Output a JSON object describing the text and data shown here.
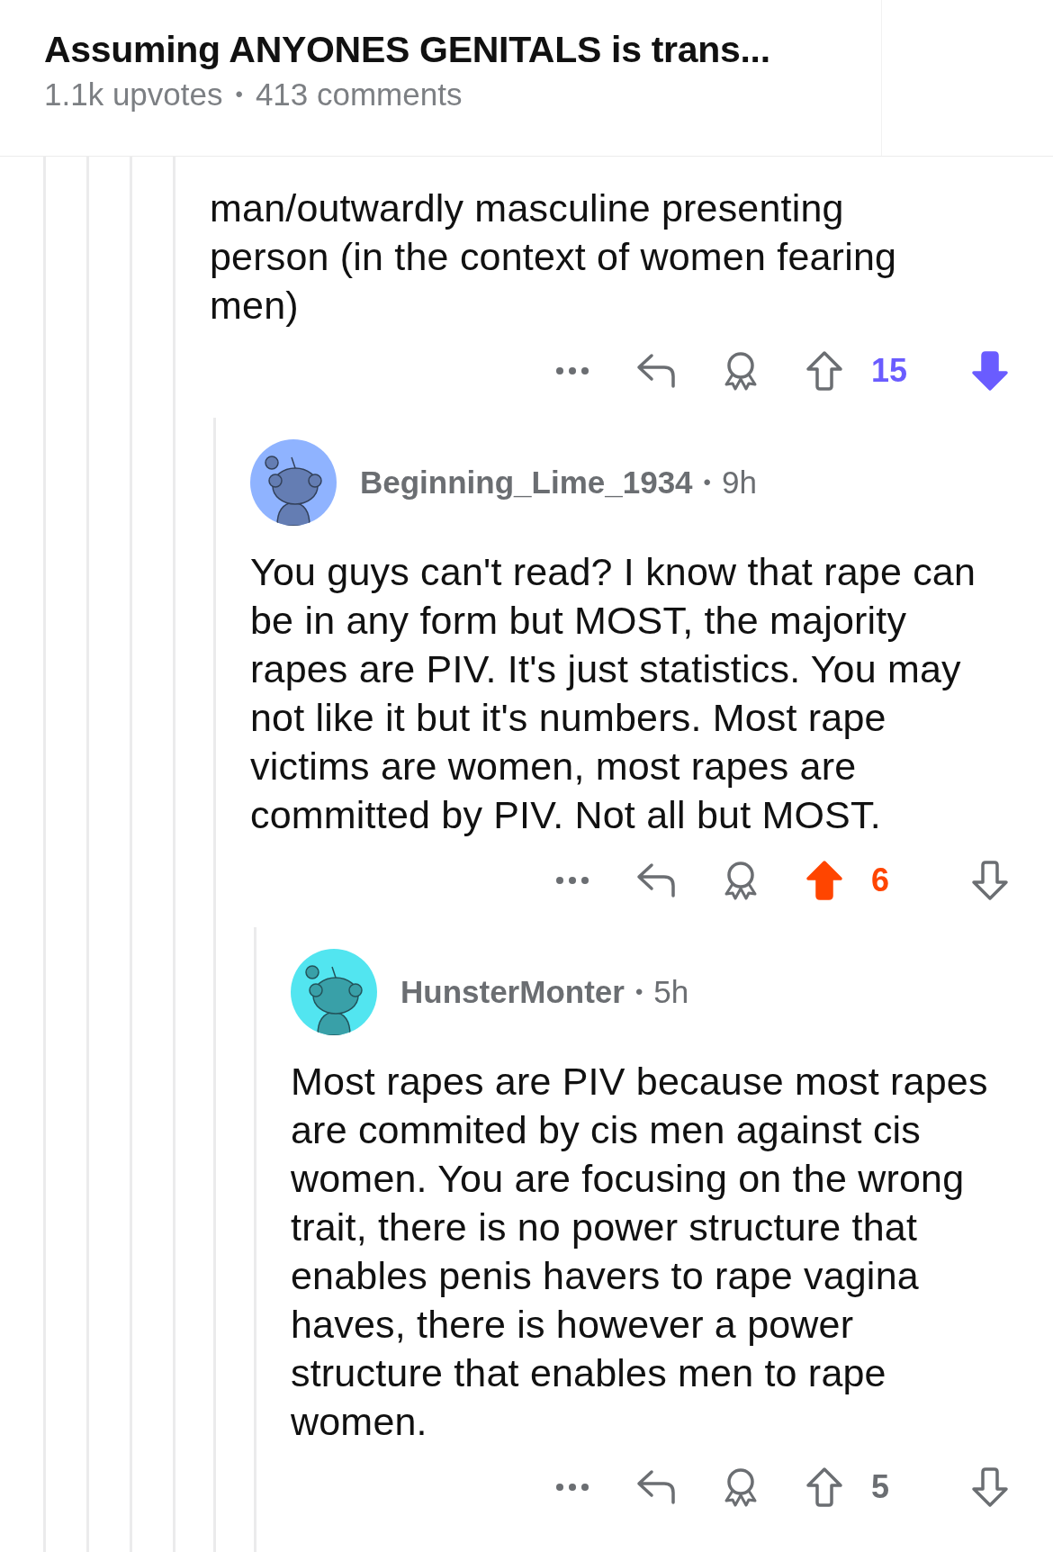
{
  "header": {
    "title": "Assuming ANYONES GENITALS is trans...",
    "upvotes": "1.1k upvotes",
    "separator": "•",
    "comments": "413 comments"
  },
  "comment": {
    "body": "man/outwardly masculine presenting person (in the context of women fearing men)",
    "upvoted": false,
    "downvoted": true,
    "score": "15",
    "replies": [
      {
        "author": "Beginning_Lime_1934",
        "separator": "•",
        "age": "9h",
        "color": "#8fb3ff",
        "body": "You guys can't read? I know that rape can be in any form but MOST, the majority rapes are PIV. It's just statistics. You may not like it but it's numbers. Most rape victims are women, most rapes are committed by PIV. Not all but MOST.",
        "upvoted": true,
        "downvoted": false,
        "score": "6",
        "replies": [
          {
            "author": "HunsterMonter",
            "separator": "•",
            "age": "5h",
            "color": "#52e5f0",
            "body": "Most rapes are PIV because most rapes are commited by cis men against cis women. You are focusing on the wrong trait, there is no power structure that enables penis havers to rape vagina haves, there is however a power structure that enables men to rape women.",
            "upvoted": false,
            "downvoted": false,
            "score": "5"
          }
        ]
      }
    ]
  }
}
